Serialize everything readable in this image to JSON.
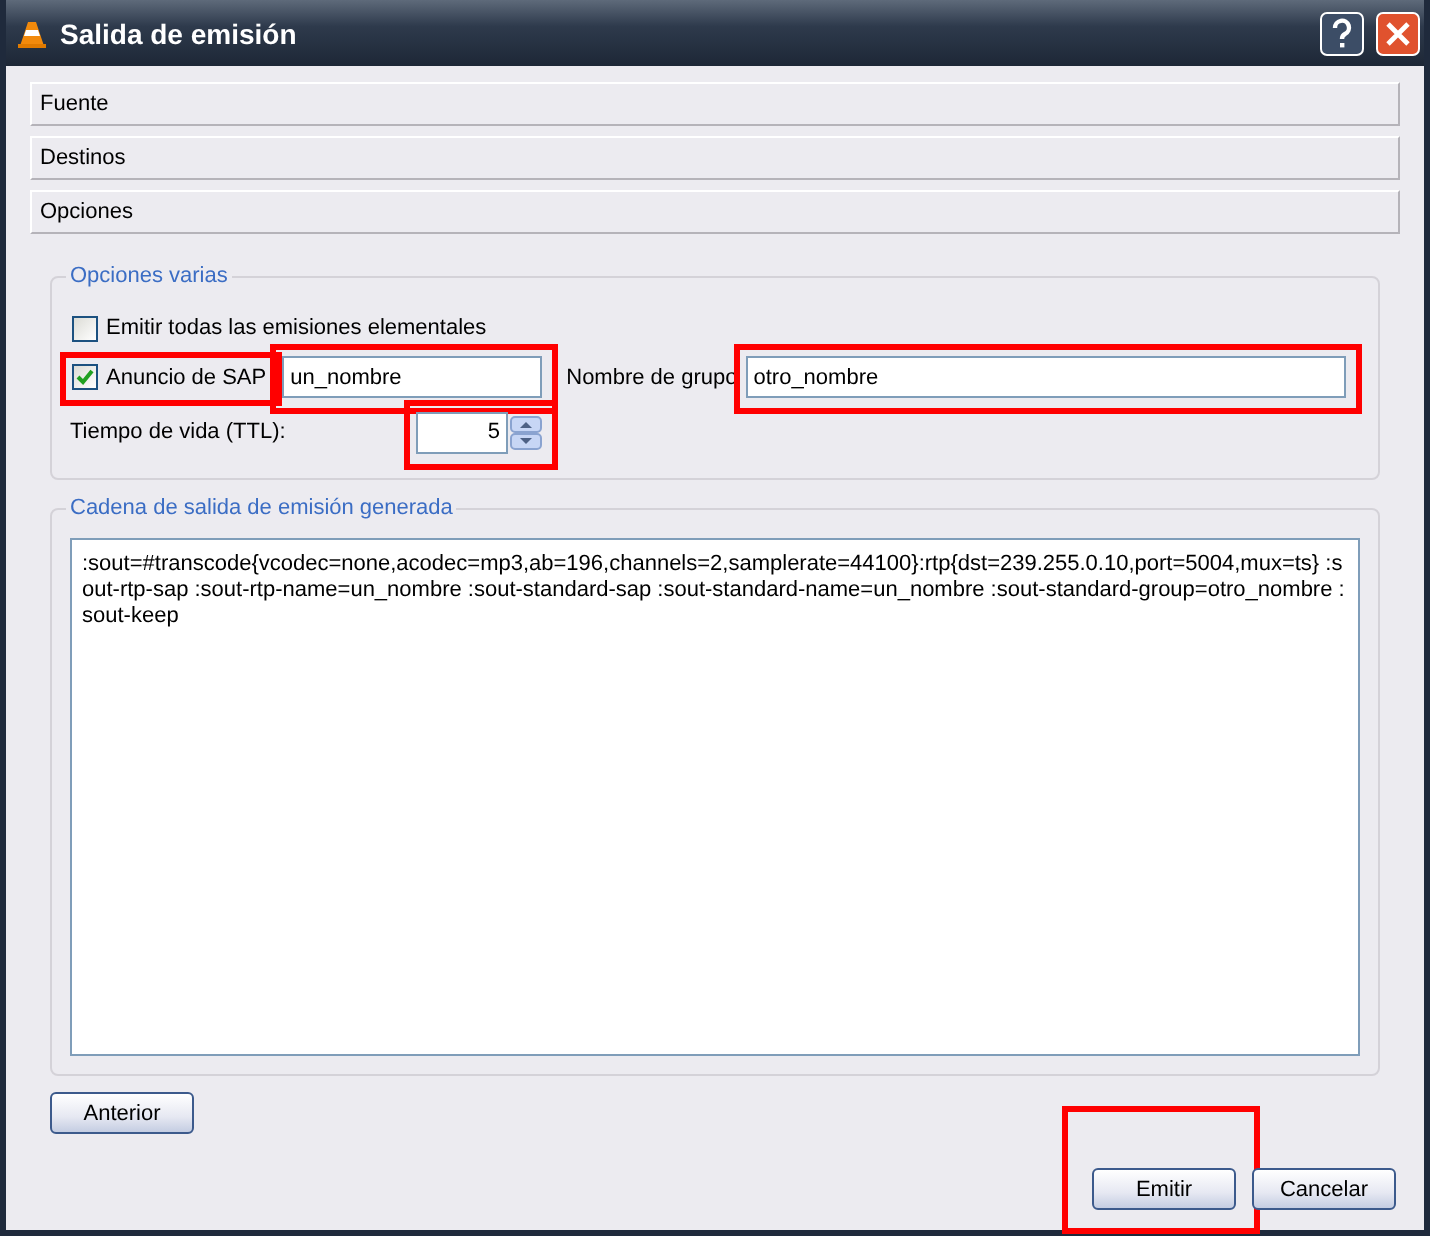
{
  "window": {
    "title": "Salida de emisión"
  },
  "sections": [
    {
      "label": "Fuente"
    },
    {
      "label": "Destinos"
    },
    {
      "label": "Opciones"
    }
  ],
  "options_group": {
    "title": "Opciones varias",
    "all_streams": {
      "label": "Emitir todas las emisiones elementales",
      "checked": false,
      "highlighted": false
    },
    "sap": {
      "label": "Anuncio de SAP",
      "checked": true,
      "highlighted": true
    },
    "sap_name": {
      "value": "un_nombre",
      "highlighted": true
    },
    "group_label": "Nombre de grupo",
    "group_name": {
      "value": "otro_nombre",
      "highlighted": true
    },
    "ttl_label": "Tiempo de vida (TTL):",
    "ttl": {
      "value": "5",
      "highlighted": true
    }
  },
  "output_group": {
    "title": "Cadena de salida de emisión generada",
    "text": ":sout=#transcode{vcodec=none,acodec=mp3,ab=196,channels=2,samplerate=44100}:rtp{dst=239.255.0.10,port=5004,mux=ts} :sout-rtp-sap :sout-rtp-name=un_nombre :sout-standard-sap :sout-standard-name=un_nombre :sout-standard-group=otro_nombre :sout-keep"
  },
  "buttons": [
    {
      "label": "Anterior",
      "highlighted": false
    },
    {
      "label": "Emitir",
      "highlighted": true
    },
    {
      "label": "Cancelar",
      "highlighted": false
    }
  ]
}
